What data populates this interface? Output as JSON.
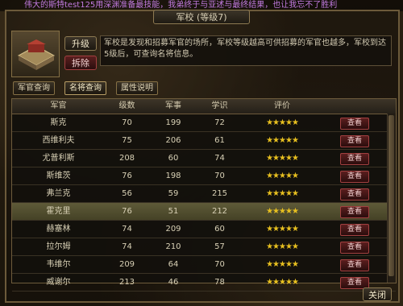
{
  "ticker": "伟大的斯特test125用深渊准备最技能，我弟终于与亚述与最终结果，也让我忘不了胜利",
  "window": {
    "title": "军校 (等级7)"
  },
  "building": {
    "upgrade_label": "升级",
    "demolish_label": "拆除",
    "description": "军校是发现和招募军官的场所，军校等级越高可供招募的军官也越多，军校到达5级后，可查询名将信息。"
  },
  "tabs": [
    {
      "label": "军官查询"
    },
    {
      "label": "名将查询"
    },
    {
      "label": "属性说明"
    }
  ],
  "table": {
    "headers": [
      "军官",
      "级数",
      "军事",
      "学识",
      "评价"
    ],
    "rows": [
      {
        "name": "斯克",
        "level": "70",
        "military": "199",
        "learning": "72",
        "rating": "★★★★★",
        "action": "查看"
      },
      {
        "name": "西维利夫",
        "level": "75",
        "military": "206",
        "learning": "61",
        "rating": "★★★★★",
        "action": "查看"
      },
      {
        "name": "尤普利斯",
        "level": "208",
        "military": "60",
        "learning": "74",
        "rating": "★★★★★",
        "action": "查看"
      },
      {
        "name": "斯维茨",
        "level": "76",
        "military": "198",
        "learning": "70",
        "rating": "★★★★★",
        "action": "查看"
      },
      {
        "name": "弗兰克",
        "level": "56",
        "military": "59",
        "learning": "215",
        "rating": "★★★★★",
        "action": "查看"
      },
      {
        "name": "霍克里",
        "level": "76",
        "military": "51",
        "learning": "212",
        "rating": "★★★★★",
        "action": "查看"
      },
      {
        "name": "赫塞林",
        "level": "74",
        "military": "209",
        "learning": "60",
        "rating": "★★★★★",
        "action": "查看"
      },
      {
        "name": "拉尔姆",
        "level": "74",
        "military": "210",
        "learning": "57",
        "rating": "★★★★★",
        "action": "查看"
      },
      {
        "name": "韦维尔",
        "level": "209",
        "military": "64",
        "learning": "70",
        "rating": "★★★★★",
        "action": "查看"
      },
      {
        "name": "威谢尔",
        "level": "213",
        "military": "46",
        "learning": "78",
        "rating": "★★★★★",
        "action": "查看"
      }
    ]
  },
  "close_label": "关闭",
  "colors": {
    "accent": "#e8c020",
    "panel_border": "#6c5a3a",
    "selected_row": "#5e5a38"
  }
}
